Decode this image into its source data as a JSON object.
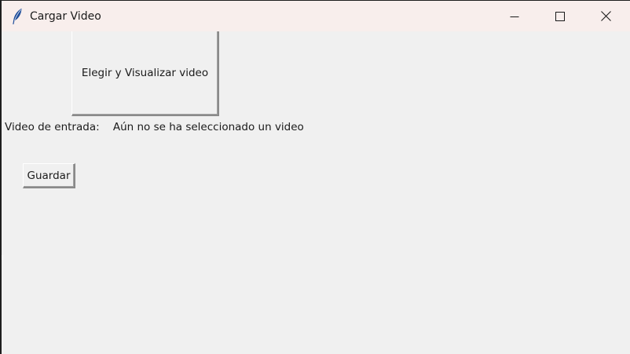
{
  "window": {
    "title": "Cargar Video",
    "icon": "feather-icon",
    "controls": {
      "minimize": "minimize-icon",
      "maximize": "maximize-icon",
      "close": "close-icon"
    }
  },
  "main": {
    "choose_button_label": "Elegir y Visualizar video",
    "input_label": "Video de entrada:",
    "input_status": "Aún no se ha seleccionado un video",
    "save_button_label": "Guardar"
  },
  "colors": {
    "titlebar": "#f8eeec",
    "background": "#f0f0f0",
    "feather": "#1f4e9a"
  }
}
